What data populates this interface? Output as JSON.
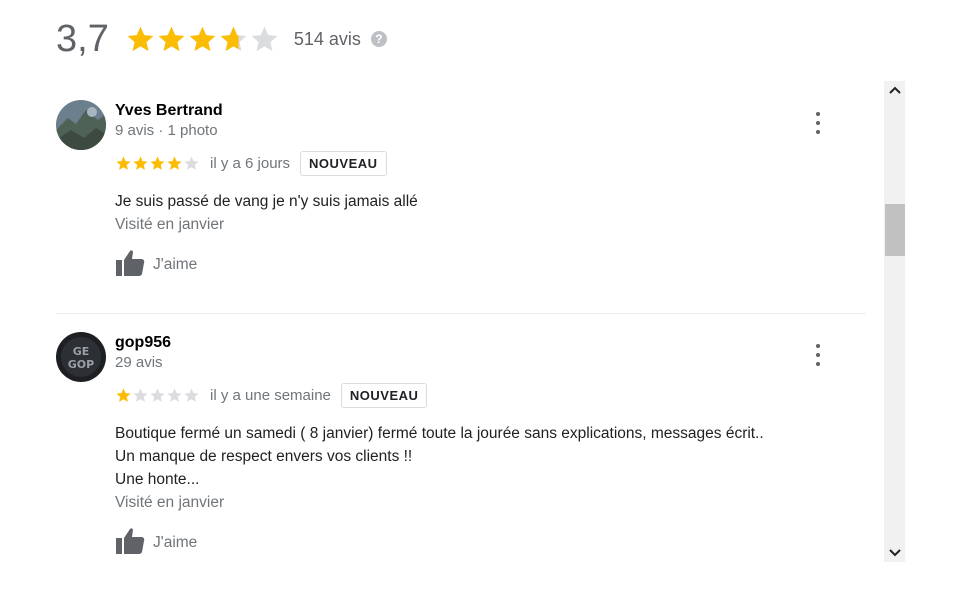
{
  "summary": {
    "score": "3,7",
    "rating": 3.7,
    "count_label": "514 avis",
    "help_icon": "?"
  },
  "reviews": [
    {
      "author": "Yves Bertrand",
      "meta": "9 avis · 1 photo",
      "rating": 4,
      "date": "il y a 6 jours",
      "badge": "NOUVEAU",
      "text_lines": [
        "Je suis passé de vang je n'y suis jamais allé"
      ],
      "visited": "Visité en janvier",
      "like_label": "J'aime"
    },
    {
      "author": "gop956",
      "meta": "29 avis",
      "rating": 1,
      "date": "il y a une semaine",
      "badge": "NOUVEAU",
      "text_lines": [
        "Boutique fermé un samedi ( 8 janvier)  fermé toute la jourée sans explications, messages écrit..",
        "Un manque de respect envers vos clients !!",
        "Une honte..."
      ],
      "visited": "Visité en janvier",
      "like_label": "J'aime"
    }
  ],
  "colors": {
    "star_filled": "#fbbc04",
    "star_empty": "#dadce0",
    "muted_text": "#70757a"
  }
}
